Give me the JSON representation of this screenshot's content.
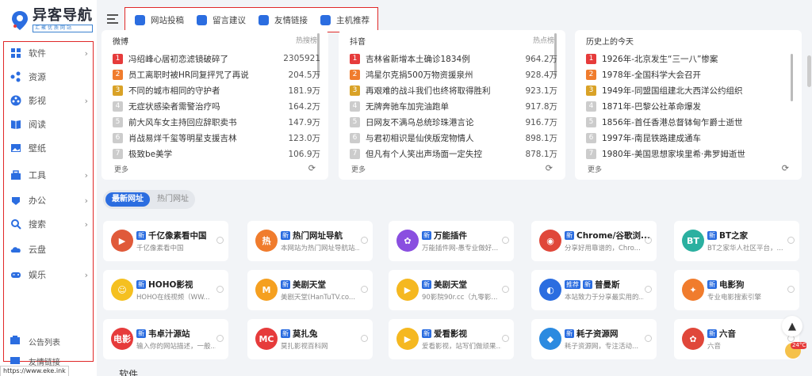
{
  "brand": {
    "title": "异客导航",
    "subtitle": "汇聚优质网站"
  },
  "topbar": {
    "items": [
      {
        "label": "网站投稿",
        "color": "#2b6de0"
      },
      {
        "label": "留言建议",
        "color": "#2b6de0"
      },
      {
        "label": "友情链接",
        "color": "#2b6de0"
      },
      {
        "label": "主机推荐",
        "color": "#2b6de0"
      }
    ]
  },
  "sidebar": {
    "items": [
      {
        "label": "软件",
        "icon": "grid-icon",
        "arrow": "›"
      },
      {
        "label": "资源",
        "icon": "nodes-icon",
        "arrow": ""
      },
      {
        "label": "影视",
        "icon": "film-reel-icon",
        "arrow": "›"
      },
      {
        "label": "阅读",
        "icon": "book-icon",
        "arrow": ""
      },
      {
        "label": "壁纸",
        "icon": "picture-icon",
        "arrow": ""
      },
      {
        "label": "工具",
        "icon": "toolbox-icon",
        "arrow": "›"
      },
      {
        "label": "办公",
        "icon": "office-icon",
        "arrow": "›"
      },
      {
        "label": "搜索",
        "icon": "search-icon",
        "arrow": "›"
      },
      {
        "label": "云盘",
        "icon": "cloud-icon",
        "arrow": ""
      },
      {
        "label": "娱乐",
        "icon": "gamepad-icon",
        "arrow": "›"
      }
    ],
    "notice": "公告列表",
    "friend": "友情链接"
  },
  "hot": [
    {
      "source": "微博",
      "label": "热搜榜",
      "rows": [
        {
          "rank": "1",
          "title": "冯绍峰心居初恋滤镜破碎了",
          "value": "2305921"
        },
        {
          "rank": "2",
          "title": "员工离职时被HR同复抨咒了再说",
          "value": "204.5万"
        },
        {
          "rank": "3",
          "title": "不同的城市相同的守护者",
          "value": "181.9万"
        },
        {
          "rank": "4",
          "title": "无症状感染者需警治疗吗",
          "value": "164.2万"
        },
        {
          "rank": "5",
          "title": "前大风车女主持回应辞职卖书",
          "value": "147.9万"
        },
        {
          "rank": "6",
          "title": "肖战易烊千玺等明星支援吉林",
          "value": "123.0万"
        },
        {
          "rank": "7",
          "title": "极致be美学",
          "value": "106.9万"
        }
      ],
      "more": "更多"
    },
    {
      "source": "抖音",
      "label": "热点榜",
      "rows": [
        {
          "rank": "1",
          "title": "吉林省新增本土确诊1834例",
          "value": "964.2万"
        },
        {
          "rank": "2",
          "title": "鸿星尔克捐500万物资援泉州",
          "value": "928.4万"
        },
        {
          "rank": "3",
          "title": "再艰难的战斗我们也终将取得胜利",
          "value": "923.1万"
        },
        {
          "rank": "4",
          "title": "无牌奔驰车加完油跑单",
          "value": "917.8万"
        },
        {
          "rank": "5",
          "title": "日网友不满乌总统珍珠港言论",
          "value": "916.7万"
        },
        {
          "rank": "6",
          "title": "与君初相识是仙侠版宠物情人",
          "value": "898.1万"
        },
        {
          "rank": "7",
          "title": "但凡有个人笑出声场面一定失控",
          "value": "878.1万"
        }
      ],
      "more": "更多"
    },
    {
      "source": "历史上的今天",
      "label": "",
      "rows": [
        {
          "rank": "1",
          "title": "1926年-北京发生“三一八”惨案",
          "value": ""
        },
        {
          "rank": "2",
          "title": "1978年-全国科学大会召开",
          "value": ""
        },
        {
          "rank": "3",
          "title": "1949年-同盟国组建北大西洋公约组织",
          "value": ""
        },
        {
          "rank": "4",
          "title": "1871年-巴黎公社革命爆发",
          "value": ""
        },
        {
          "rank": "5",
          "title": "1856年-首任香港总督钵甸乍爵士逝世",
          "value": ""
        },
        {
          "rank": "6",
          "title": "1997年-南昆铁路建成通车",
          "value": ""
        },
        {
          "rank": "7",
          "title": "1980年-美国思想家埃里希·弗罗姆逝世",
          "value": ""
        }
      ],
      "more": "更多"
    }
  ],
  "tabs": {
    "latest": "最新网址",
    "popular": "热门网址"
  },
  "cards": [
    {
      "tag": "新",
      "name": "千亿像素看中国",
      "desc": "千亿像素看中国",
      "icon_color": "#e05a3a",
      "icon_text": "▶"
    },
    {
      "tag": "新",
      "name": "热门网址导航",
      "desc": "本网站为热门网址导航站...",
      "icon_color": "#f07c2d",
      "icon_text": "热"
    },
    {
      "tag": "新",
      "name": "万能插件",
      "desc": "万能插件网-愚专业做好...",
      "icon_color": "#8a4fe0",
      "icon_text": "✿"
    },
    {
      "tag": "新",
      "name": "Chrome/谷歌浏...",
      "desc": "分享好用靠谱的，Chro...",
      "icon_color": "#e0473a",
      "icon_text": "◉"
    },
    {
      "tag": "新",
      "name": "BT之家",
      "desc": "BT之家华人社区平台，...",
      "icon_color": "#2bb0a0",
      "icon_text": "BT"
    },
    {
      "tag": "新",
      "name": "HOHO影视",
      "desc": "HOHO在线视频（WW...",
      "icon_color": "#f5c020",
      "icon_text": "☺"
    },
    {
      "tag": "新",
      "name": "美剧天堂",
      "desc": "美剧天堂(HanTuTV.co...",
      "icon_color": "#f5a020",
      "icon_text": "M"
    },
    {
      "tag": "新",
      "name": "美剧天堂",
      "desc": "90影院90r.cc（九零影...",
      "icon_color": "#f5b820",
      "icon_text": "▶"
    },
    {
      "tag": "推荐",
      "tag2": "新",
      "name": "普曼斯",
      "desc": "本站致力于分享最实用的...",
      "icon_color": "#2b6de0",
      "icon_text": "◐"
    },
    {
      "tag": "新",
      "name": "电影狗",
      "desc": "专业电影搜索引擎",
      "icon_color": "#f07c2d",
      "icon_text": "✦"
    },
    {
      "tag": "新",
      "name": "韦卓汁源站",
      "desc": "输入你的网站描述，一般...",
      "icon_color": "#e63b3b",
      "icon_text": "电影"
    },
    {
      "tag": "新",
      "name": "莫扎兔",
      "desc": "莫扎影视百科网",
      "icon_color": "#e63b3b",
      "icon_text": "MC"
    },
    {
      "tag": "新",
      "name": "爱看影视",
      "desc": "爱看影视，站写们做顽果...",
      "icon_color": "#f5b820",
      "icon_text": "▶"
    },
    {
      "tag": "新",
      "name": "耗子资源网",
      "desc": "耗子资源网，专注活动...",
      "icon_color": "#2b8ae0",
      "icon_text": "◆"
    },
    {
      "tag": "新",
      "name": "六音",
      "desc": "六音",
      "icon_color": "#e0473a",
      "icon_text": "✿"
    }
  ],
  "section_next": "软件",
  "status_url": "https://www.eke.ink",
  "weather": {
    "temp": "24°C"
  },
  "accent": "#2b6de0",
  "highlight_border": "#e02828"
}
